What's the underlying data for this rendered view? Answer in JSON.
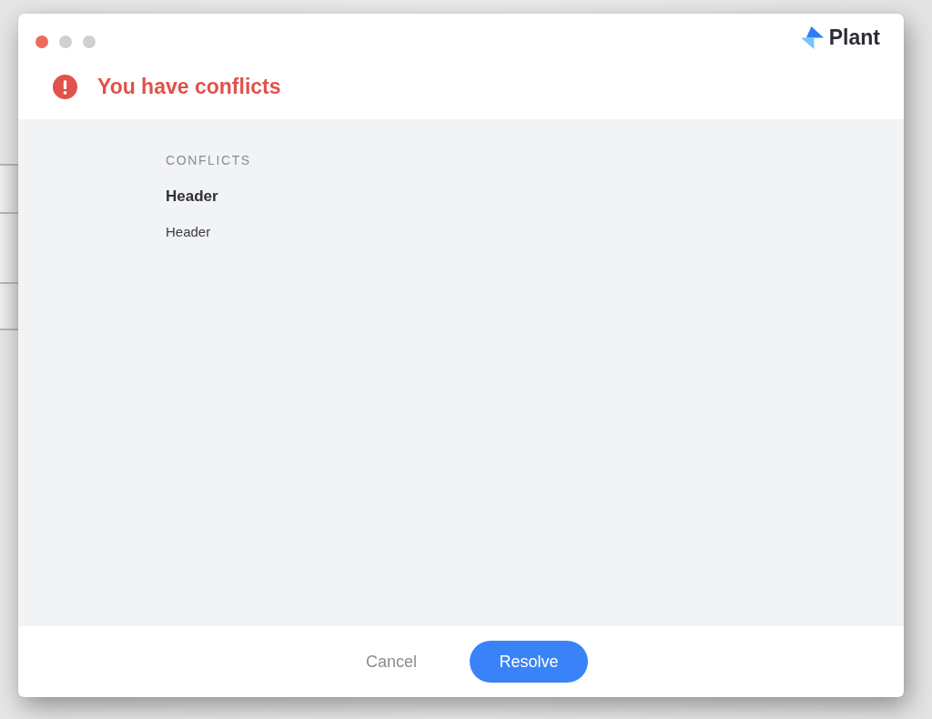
{
  "window": {
    "controls": [
      {
        "kind": "close",
        "disabled": false
      },
      {
        "kind": "minimize",
        "disabled": true
      },
      {
        "kind": "zoom",
        "disabled": true
      }
    ],
    "brand": {
      "name": "Plant"
    },
    "title": "You have conflicts"
  },
  "conflicts": {
    "heading": "CONFLICTS",
    "items": [
      {
        "title": "Header",
        "detail": "Header"
      }
    ]
  },
  "buttons": [
    {
      "label": "Cancel",
      "kind": "text"
    },
    {
      "label": "Resolve",
      "kind": "primary"
    }
  ]
}
